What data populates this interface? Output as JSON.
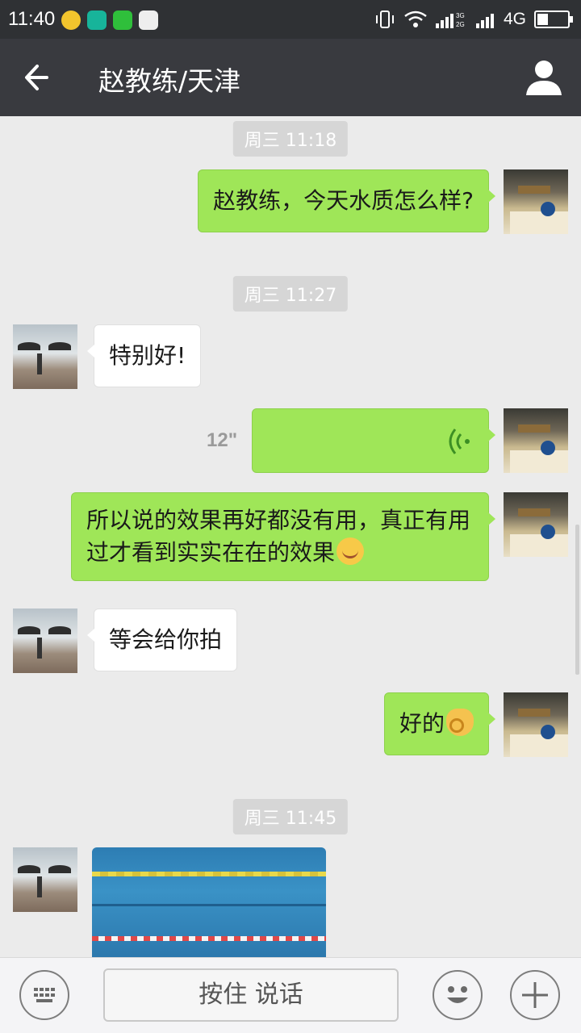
{
  "status_bar": {
    "time": "11:40",
    "network": "4G",
    "battery_level": 0.35,
    "app_icons": [
      "plus-app-icon",
      "circle-app-icon",
      "wechat-icon",
      "photos-icon"
    ]
  },
  "header": {
    "title": "赵教练/天津",
    "back_icon": "back-arrow-icon",
    "profile_icon": "person-icon"
  },
  "messages": [
    {
      "type": "time",
      "text": "周三 11:18"
    },
    {
      "type": "text",
      "from": "me",
      "text": "赵教练，今天水质怎么样?"
    },
    {
      "type": "time",
      "text": "周三 11:27"
    },
    {
      "type": "text",
      "from": "them",
      "text": "特别好!"
    },
    {
      "type": "voice",
      "from": "me",
      "duration": "12\""
    },
    {
      "type": "text",
      "from": "me",
      "text": "所以说的效果再好都没有用，真正有用过才看到实实在在的效果",
      "emoji": "smile"
    },
    {
      "type": "text",
      "from": "them",
      "text": "等会给你拍"
    },
    {
      "type": "text",
      "from": "me",
      "text": "好的",
      "emoji": "ok-hand"
    },
    {
      "type": "time",
      "text": "周三 11:45"
    },
    {
      "type": "image",
      "from": "them",
      "description": ""
    }
  ],
  "input_bar": {
    "keyboard_icon": "keyboard-icon",
    "hold_to_talk": "按住 说话",
    "emoji_icon": "emoji-face-icon",
    "plus_icon": "plus-icon"
  },
  "colors": {
    "status_bar": "#2f3134",
    "title_bar": "#393a3f",
    "chat_bg": "#ebebeb",
    "bubble_me": "#9fe658",
    "bubble_them": "#ffffff"
  }
}
